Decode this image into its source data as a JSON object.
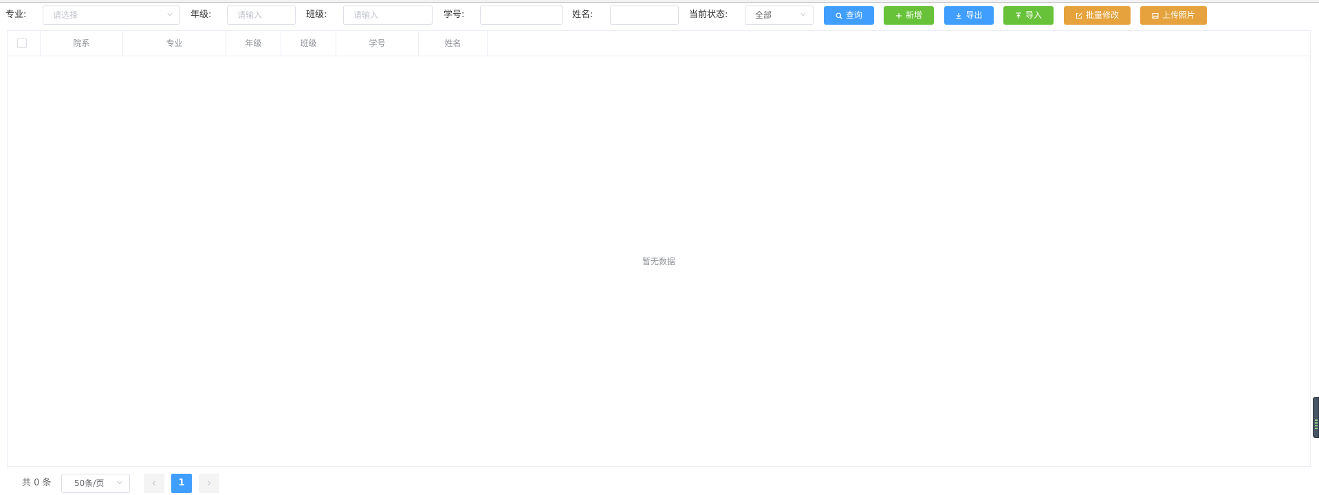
{
  "filters": {
    "major_label": "专业:",
    "major_placeholder": "请选择",
    "grade_label": "年级:",
    "grade_placeholder": "请输入",
    "class_label": "班级:",
    "class_placeholder": "请输入",
    "student_id_label": "学号:",
    "student_id_value": "",
    "name_label": "姓名:",
    "name_value": "",
    "status_label": "当前状态:",
    "status_value": "全部"
  },
  "buttons": {
    "query": "查询",
    "add": "新增",
    "export": "导出",
    "import": "导入",
    "batch_edit": "批量修改",
    "upload_photo": "上传照片"
  },
  "table": {
    "columns": [
      "院系",
      "专业",
      "年级",
      "班级",
      "学号",
      "姓名"
    ],
    "rows": [],
    "empty_text": "暂无数据"
  },
  "pagination": {
    "total_text": "共 0 条",
    "page_size": "50条/页",
    "current_page": "1"
  },
  "colors": {
    "primary": "#409eff",
    "success": "#67c23a",
    "warning": "#e6a23c"
  }
}
